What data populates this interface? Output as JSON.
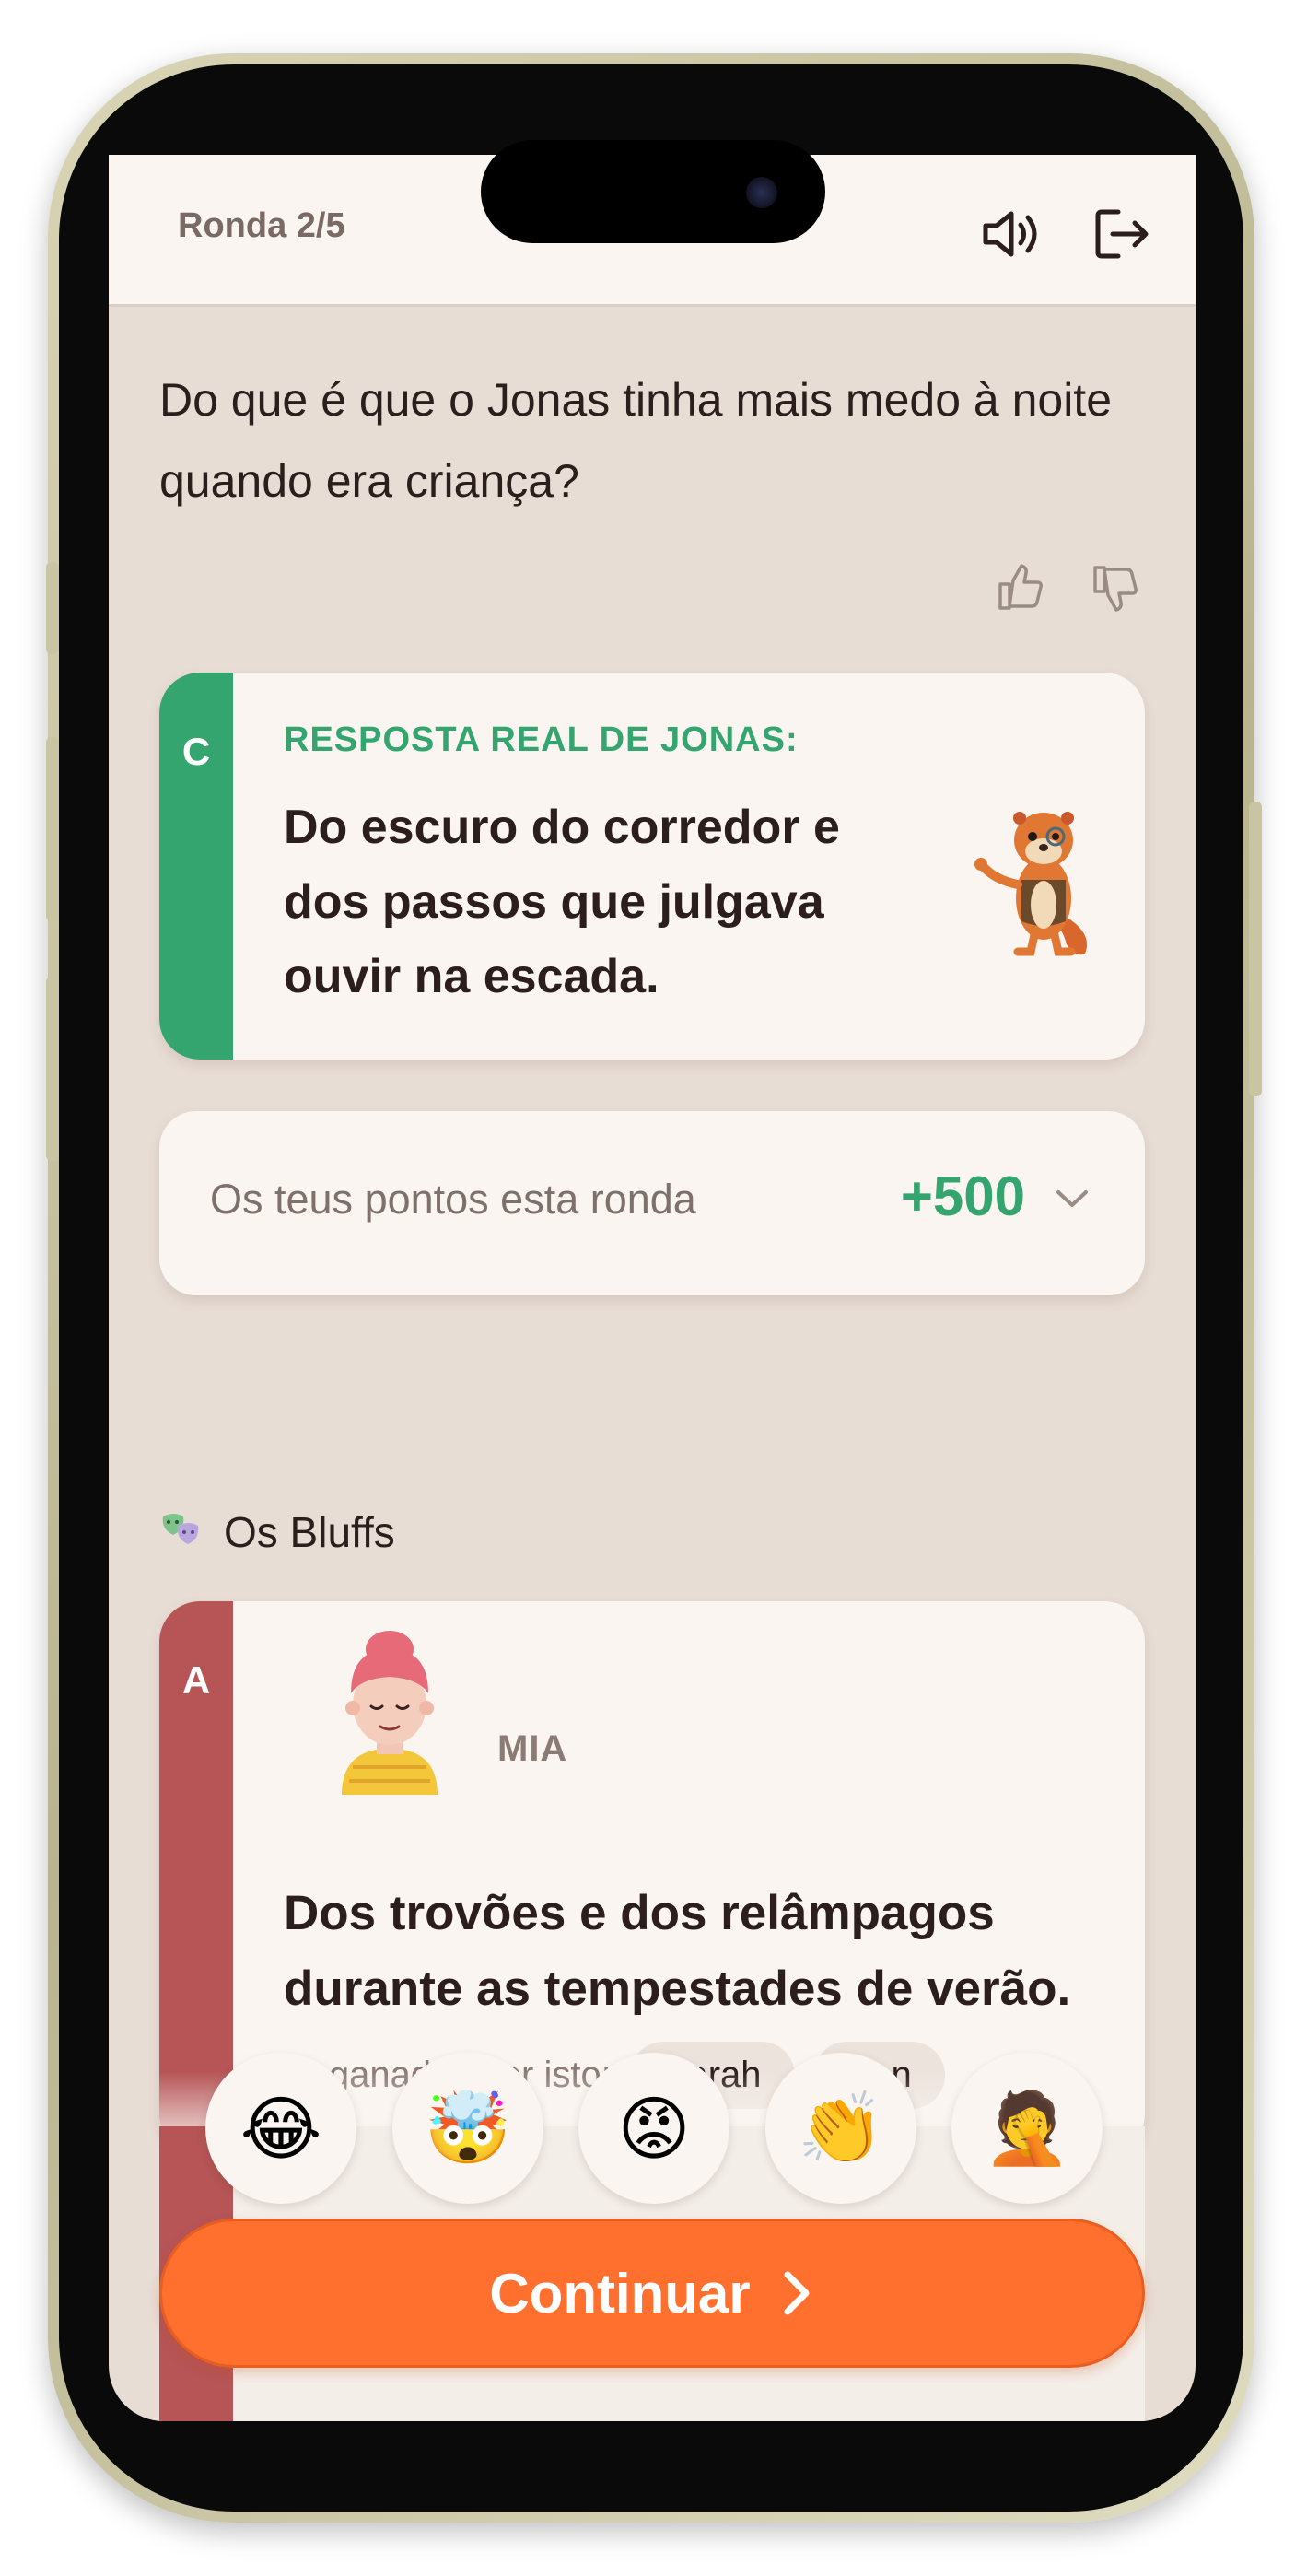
{
  "header": {
    "round_label": "Ronda 2/5",
    "sound_icon": "speaker-icon",
    "exit_icon": "exit-icon"
  },
  "question": {
    "text": "Do que é que o Jonas tinha mais medo à noite quando era criança?"
  },
  "feedback": {
    "like_icon": "thumbs-up-icon",
    "dislike_icon": "thumbs-down-icon"
  },
  "real_answer": {
    "letter": "C",
    "title": "RESPOSTA REAL DE JONAS:",
    "text": "Do escuro do corredor e dos passos que julgava ouvir na escada.",
    "accent_color": "#35a56f",
    "mascot_icon": "otter-mascot-icon"
  },
  "points": {
    "label": "Os teus pontos esta ronda",
    "value": "+500",
    "expand_icon": "chevron-down-icon"
  },
  "bluffs_section": {
    "icon": "theater-masks-icon",
    "title": "Os Bluffs"
  },
  "bluffs": [
    {
      "letter": "A",
      "player": "MIA",
      "text": "Dos trovões e dos relâmpagos durante as tempestades de verão.",
      "fooled_label": "Enganados por isto:",
      "fooled": [
        "Sarah",
        "Ben"
      ],
      "accent_color": "#b65456"
    }
  ],
  "reactions": [
    {
      "name": "laugh-emoji",
      "glyph": "😂"
    },
    {
      "name": "mind-blown-emoji",
      "glyph": "🤯"
    },
    {
      "name": "angry-emoji",
      "glyph": "😡"
    },
    {
      "name": "clap-emoji",
      "glyph": "👏"
    },
    {
      "name": "facepalm-emoji",
      "glyph": "🤦"
    }
  ],
  "continue_button": {
    "label": "Continuar",
    "color": "#ff6f2e"
  }
}
